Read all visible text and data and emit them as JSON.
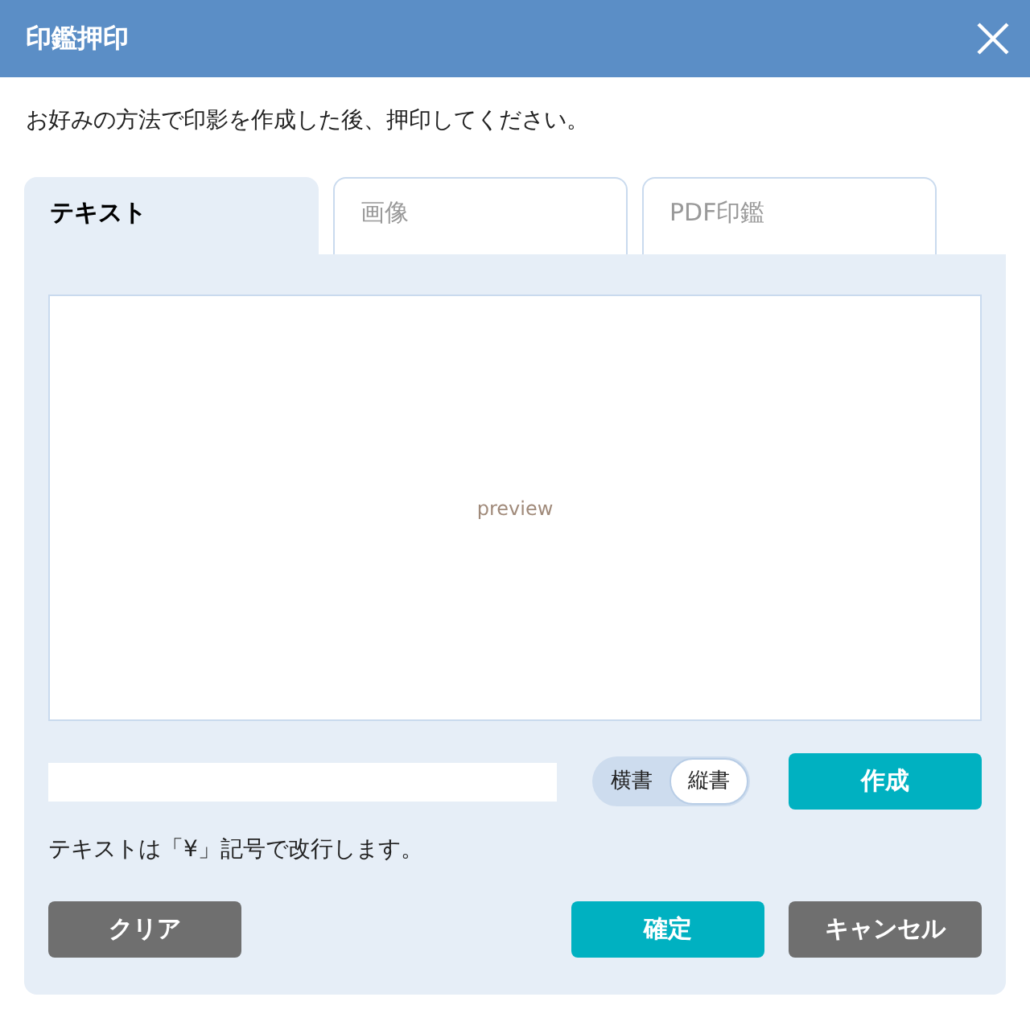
{
  "window": {
    "title": "印鑑押印"
  },
  "instruction": "お好みの方法で印影を作成した後、押印してください。",
  "tabs": [
    {
      "label": "テキスト",
      "selected": true
    },
    {
      "label": "画像",
      "selected": false
    },
    {
      "label": "PDF印鑑",
      "selected": false
    }
  ],
  "preview": {
    "label": "preview"
  },
  "orientation": [
    {
      "label": "横書",
      "selected": false
    },
    {
      "label": "縦書",
      "selected": true
    }
  ],
  "create_button": "作成",
  "note": "テキストは「¥」記号で改行します。",
  "buttons": [
    {
      "label": "クリア",
      "kind": "secondary"
    },
    {
      "label": "確定",
      "kind": "primary"
    },
    {
      "label": "キャンセル",
      "kind": "secondary"
    }
  ]
}
